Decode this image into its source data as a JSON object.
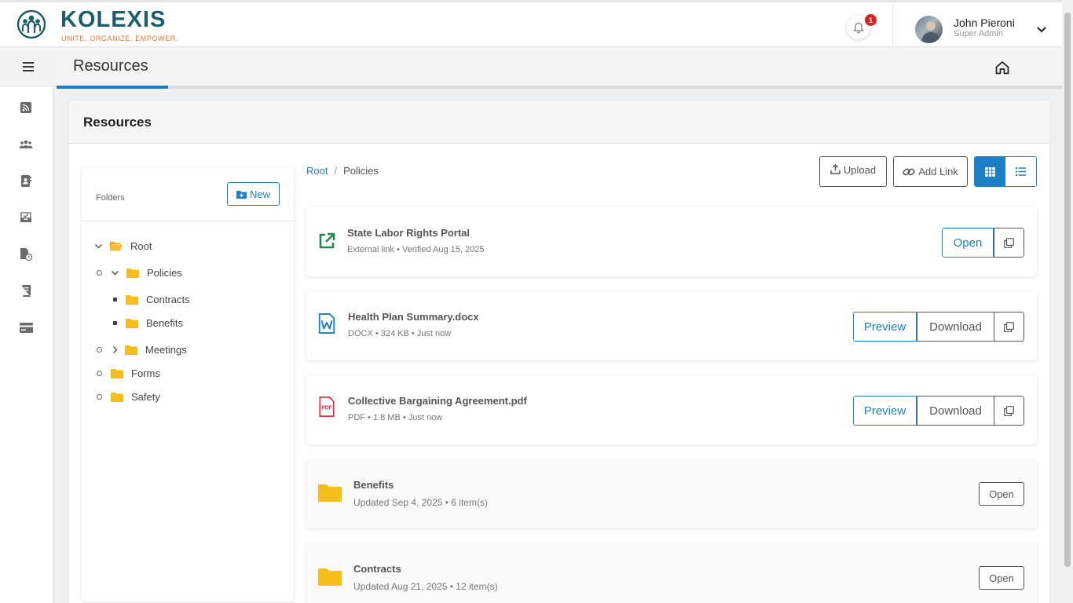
{
  "brand": {
    "name": "KOLEXIS",
    "tagline": "UNITE. ORGANIZE. EMPOWER.",
    "primary_color": "#1b5d6e",
    "accent_color": "#e0782b"
  },
  "header": {
    "notification_count": "1",
    "user_name": "John Pieroni",
    "user_role": "Super Admin"
  },
  "page": {
    "title": "Resources",
    "card_title": "Resources"
  },
  "sidebar": {
    "icons": [
      "rss-icon",
      "group-icon",
      "contacts-icon",
      "inbox-check-icon",
      "document-clock-icon",
      "book-icon",
      "credit-card-icon"
    ]
  },
  "folders": {
    "label": "Folders",
    "new_label": "New",
    "tree": [
      {
        "label": "Root"
      },
      {
        "label": "Policies"
      },
      {
        "label": "Contracts"
      },
      {
        "label": "Benefits"
      },
      {
        "label": "Meetings"
      },
      {
        "label": "Forms"
      },
      {
        "label": "Safety"
      }
    ]
  },
  "breadcrumb": {
    "root": "Root",
    "separator": "/",
    "current": "Policies"
  },
  "toolbar": {
    "upload_label": "Upload",
    "add_link_label": "Add Link"
  },
  "resources": [
    {
      "name": "State Labor Rights Portal",
      "meta": "External link • Verified Aug 15, 2025",
      "open_label": "Open"
    },
    {
      "name": "Health Plan Summary.docx",
      "meta": "DOCX • 324 KB • Just now",
      "preview_label": "Preview",
      "download_label": "Download"
    },
    {
      "name": "Collective Bargaining Agreement.pdf",
      "meta": "PDF • 1.8 MB • Just now",
      "preview_label": "Preview",
      "download_label": "Download",
      "pdf_badge": "PDF"
    },
    {
      "name": "Benefits",
      "meta": "Updated Sep 4, 2025 • 6 item(s)",
      "open_label": "Open"
    },
    {
      "name": "Contracts",
      "meta": "Updated Aug 21, 2025 • 12 item(s)",
      "open_label": "Open"
    }
  ]
}
